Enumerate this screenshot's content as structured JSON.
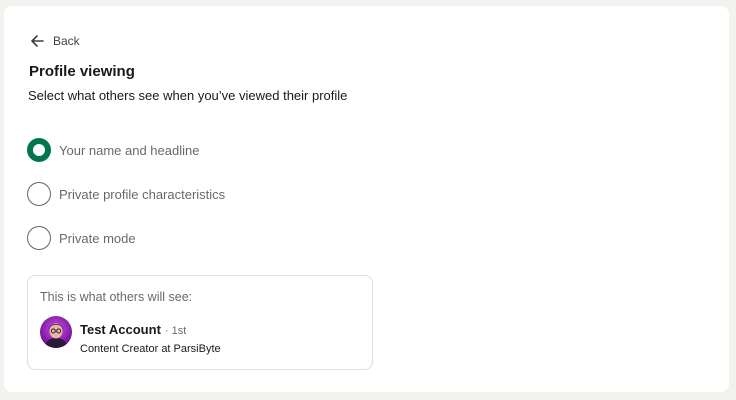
{
  "nav": {
    "back_label": "Back",
    "back_icon": "arrow-left-icon"
  },
  "section": {
    "title": "Profile viewing",
    "subtitle": "Select what others see when you’ve viewed their profile"
  },
  "options": [
    {
      "label": "Your name and headline",
      "selected": true
    },
    {
      "label": "Private profile characteristics",
      "selected": false
    },
    {
      "label": "Private mode",
      "selected": false
    }
  ],
  "preview": {
    "heading": "This is what others will see:",
    "name": "Test Account",
    "degree": "· 1st",
    "headline": "Content Creator at ParsiByte"
  },
  "colors": {
    "accent": "#01754f",
    "avatar_primary": "#a020c8"
  }
}
